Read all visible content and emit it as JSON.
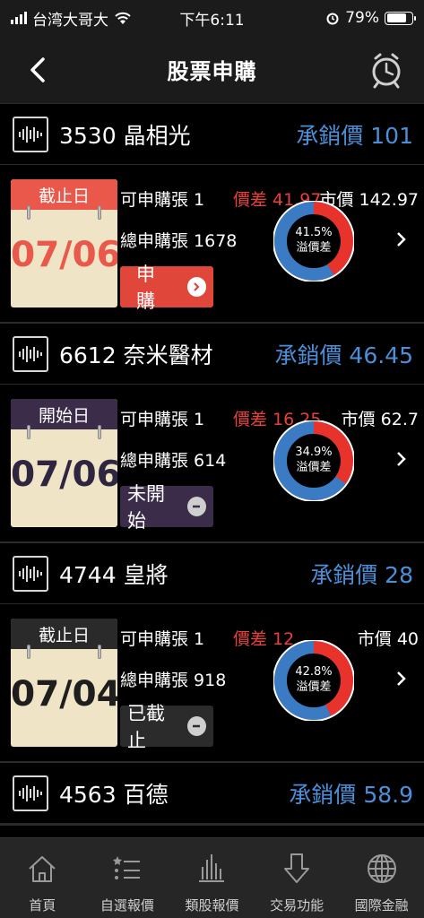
{
  "status": {
    "carrier": "台湾大哥大",
    "time": "下午6:11",
    "battery": "79%"
  },
  "nav": {
    "title": "股票申購"
  },
  "colors": {
    "accent_blue": "#4c8fd9",
    "red": "#e8403a",
    "cal_red": "#e9584a",
    "cal_purple": "#3b2c4a",
    "cal_dark": "#2a2a2a"
  },
  "stocks": [
    {
      "name": "3530 晶相光",
      "price": "承銷價 101",
      "cal_label": "截止日",
      "date": "07/06",
      "avail": "可申購張 1",
      "total": "總申購張 1678",
      "diff": "價差 41.97",
      "market": "市價 142.97",
      "pct": "41.5%",
      "pct_label": "溢價差",
      "ratio": 0.415,
      "action": "申購"
    },
    {
      "name": "6612 奈米醫材",
      "price": "承銷價 46.45",
      "cal_label": "開始日",
      "date": "07/06",
      "avail": "可申購張 1",
      "total": "總申購張 614",
      "diff": "價差 16.25",
      "market": "市價 62.7",
      "pct": "34.9%",
      "pct_label": "溢價差",
      "ratio": 0.349,
      "action": "未開始"
    },
    {
      "name": "4744 皇將",
      "price": "承銷價 28",
      "cal_label": "截止日",
      "date": "07/04",
      "avail": "可申購張 1",
      "total": "總申購張 918",
      "diff": "價差 12",
      "market": "市價 40",
      "pct": "42.8%",
      "pct_label": "溢價差",
      "ratio": 0.428,
      "action": "已截止"
    },
    {
      "name": "4563 百德",
      "price": "承銷價 58.9"
    }
  ],
  "tabs": [
    {
      "label": "首頁",
      "icon": "home-icon"
    },
    {
      "label": "自選報價",
      "icon": "watchlist-icon"
    },
    {
      "label": "類股報價",
      "icon": "sector-quote-icon"
    },
    {
      "label": "交易功能",
      "icon": "trade-icon"
    },
    {
      "label": "國際金融",
      "icon": "globe-icon"
    }
  ]
}
